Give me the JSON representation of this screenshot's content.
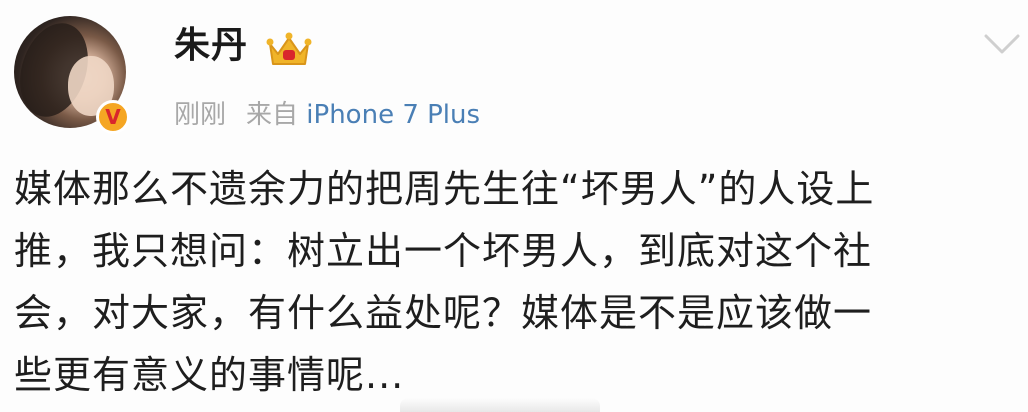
{
  "post": {
    "username": "朱丹",
    "time": "刚刚",
    "source_prefix": "来自",
    "device": "iPhone 7 Plus",
    "content_lines": [
      "媒体那么不遗余力的把周先生往“坏男人”的人设上",
      "推，我只想问：树立出一个坏男人，到底对这个社",
      "会，对大家，有什么益处呢？媒体是不是应该做一",
      "些更有意义的事情呢..."
    ],
    "badges": {
      "verified_icon": "verified-v-icon",
      "member_icon": "crown-icon"
    },
    "colors": {
      "username": "#1a1a1a",
      "meta": "#a8a8a8",
      "device_link": "#4a7fb5",
      "verified_badge": "#f5a623",
      "crown": "#f0b429"
    }
  }
}
